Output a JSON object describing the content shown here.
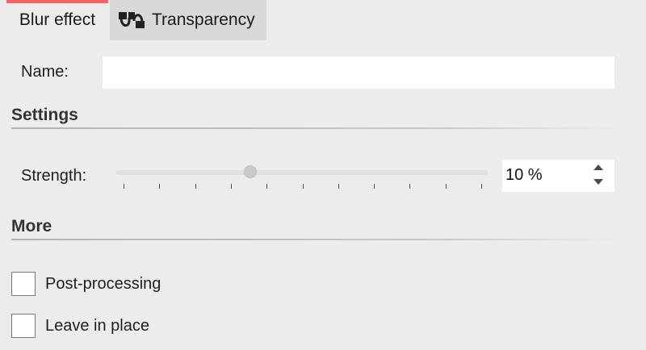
{
  "tabs": {
    "blur": {
      "label": "Blur effect"
    },
    "transparency": {
      "label": "Transparency",
      "icon": "transparency-icon"
    }
  },
  "colors": {
    "active_tab_accent": "#f26566",
    "background": "#ececec",
    "inactive_tab": "#d8d8d8"
  },
  "name_row": {
    "label": "Name:",
    "value": "",
    "placeholder": ""
  },
  "settings": {
    "title": "Settings",
    "strength": {
      "label": "Strength:",
      "value_text": "10 %",
      "slider_fraction": 0.36,
      "tick_count": 11
    }
  },
  "more": {
    "title": "More",
    "options": [
      {
        "label": "Post-processing",
        "checked": false
      },
      {
        "label": "Leave in place",
        "checked": false
      }
    ]
  }
}
